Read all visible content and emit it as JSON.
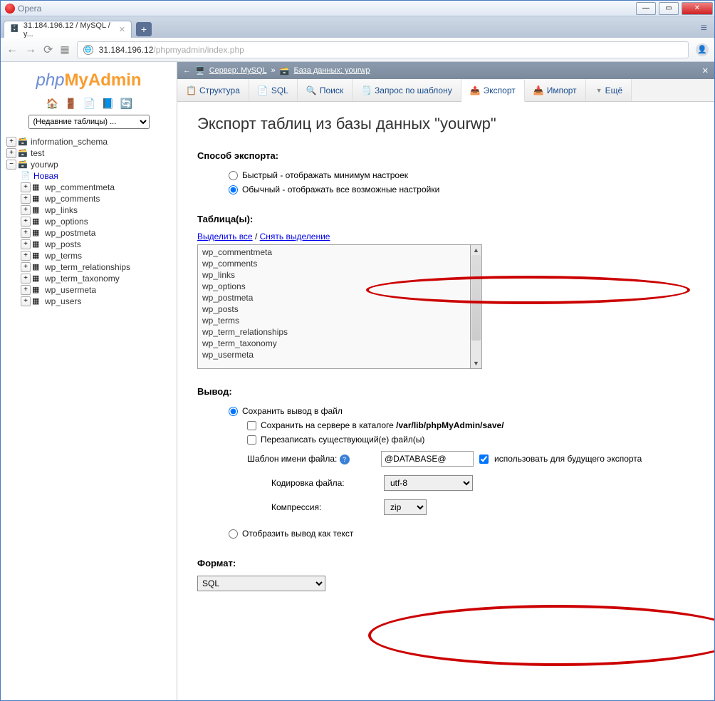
{
  "window": {
    "title": "Opera"
  },
  "browser": {
    "tab_title": "31.184.196.12 / MySQL / y...",
    "url_host": "31.184.196.12",
    "url_path": "/phpmyadmin/index.php"
  },
  "sidebar": {
    "logo_php": "php",
    "logo_my": "My",
    "logo_admin": "Admin",
    "recent_tables": "(Недавние таблицы) ...",
    "db1": "information_schema",
    "db2": "test",
    "db3": "yourwp",
    "new_table": "Новая",
    "tables": [
      "wp_commentmeta",
      "wp_comments",
      "wp_links",
      "wp_options",
      "wp_postmeta",
      "wp_posts",
      "wp_terms",
      "wp_term_relationships",
      "wp_term_taxonomy",
      "wp_usermeta",
      "wp_users"
    ]
  },
  "breadcrumb": {
    "server_label": "Сервер: MySQL",
    "db_label": "База данных: yourwp"
  },
  "tabs": {
    "structure": "Структура",
    "sql": "SQL",
    "search": "Поиск",
    "query": "Запрос по шаблону",
    "export": "Экспорт",
    "import": "Импорт",
    "more": "Ещё"
  },
  "page": {
    "heading": "Экспорт таблиц из базы данных \"yourwp\"",
    "export_method_label": "Способ экспорта:",
    "method_quick": "Быстрый - отображать минимум настроек",
    "method_custom": "Обычный - отображать все возможные настройки",
    "tables_label": "Таблица(ы):",
    "select_all": "Выделить все",
    "unselect_all": "Снять выделение",
    "table_options": [
      "wp_commentmeta",
      "wp_comments",
      "wp_links",
      "wp_options",
      "wp_postmeta",
      "wp_posts",
      "wp_terms",
      "wp_term_relationships",
      "wp_term_taxonomy",
      "wp_usermeta"
    ],
    "output_label": "Вывод:",
    "save_to_file": "Сохранить вывод в файл",
    "save_on_server_prefix": "Сохранить на сервере в каталоге ",
    "save_on_server_path": "/var/lib/phpMyAdmin/save/",
    "overwrite": "Перезаписать существующий(е) файл(ы)",
    "filename_template": "Шаблон имени файла:",
    "filename_value": "@DATABASE@",
    "use_for_future": "использовать для будущего экспорта",
    "encoding_label": "Кодировка файла:",
    "encoding_value": "utf-8",
    "compression_label": "Компрессия:",
    "compression_value": "zip",
    "display_as_text": "Отобразить вывод как текст",
    "format_label": "Формат:",
    "format_value": "SQL"
  }
}
